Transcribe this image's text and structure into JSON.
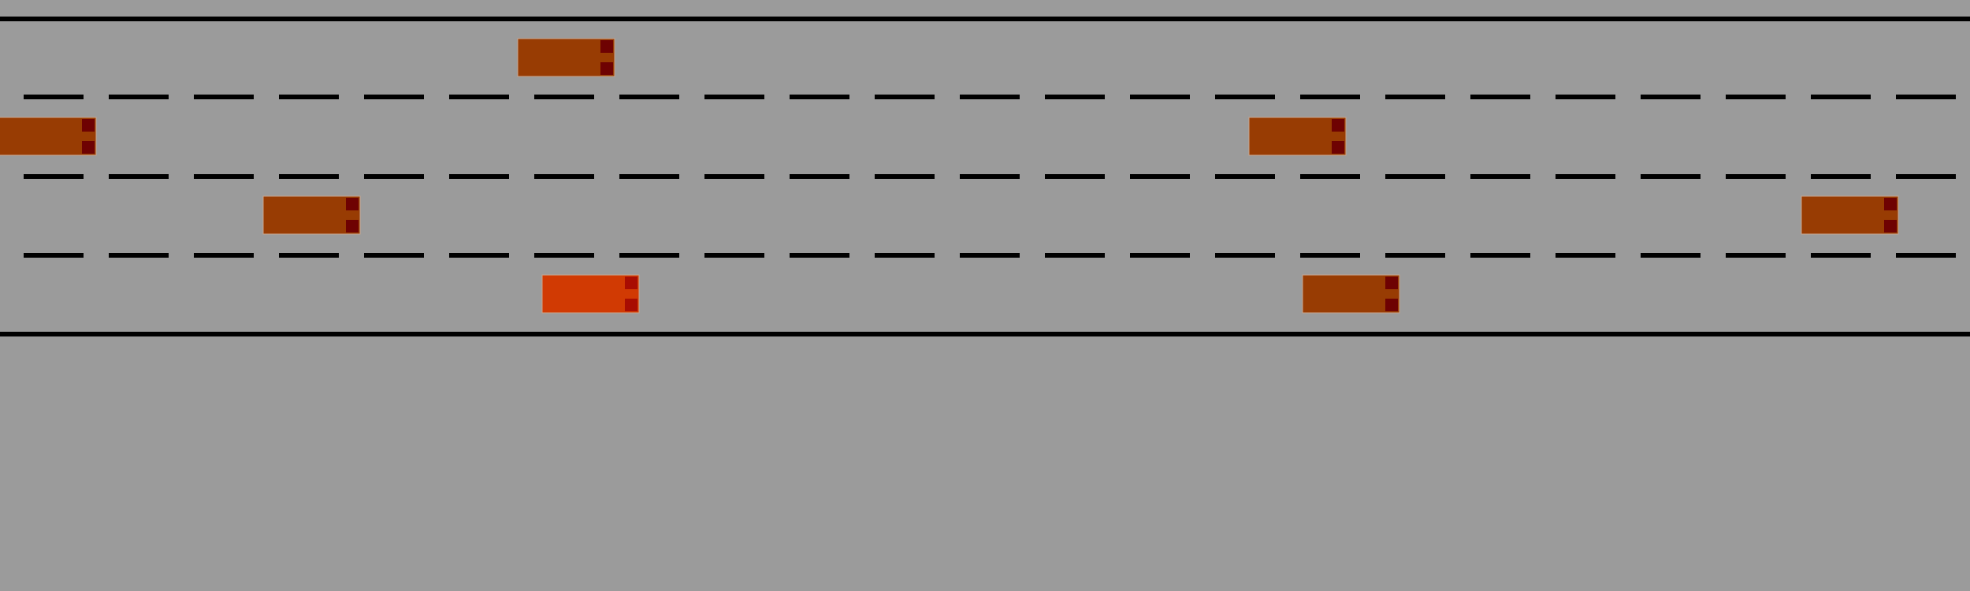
{
  "road": {
    "lane_count": 4,
    "colors": {
      "ground": "#9b9b9b",
      "edge_line": "#000000",
      "lane_divider": "#000000",
      "vehicle": "#983c03",
      "vehicle_light": "#6e0202",
      "ego_vehicle": "#d13a03",
      "ego_vehicle_light": "#a80d02"
    }
  },
  "vehicles": [
    {
      "id": "vehicle-1",
      "lane": 1,
      "ego": false
    },
    {
      "id": "vehicle-2",
      "lane": 2,
      "ego": false
    },
    {
      "id": "vehicle-3",
      "lane": 2,
      "ego": false
    },
    {
      "id": "vehicle-4",
      "lane": 3,
      "ego": false
    },
    {
      "id": "vehicle-5",
      "lane": 3,
      "ego": false
    },
    {
      "id": "ego-vehicle",
      "lane": 4,
      "ego": true
    },
    {
      "id": "vehicle-6",
      "lane": 4,
      "ego": false
    }
  ]
}
